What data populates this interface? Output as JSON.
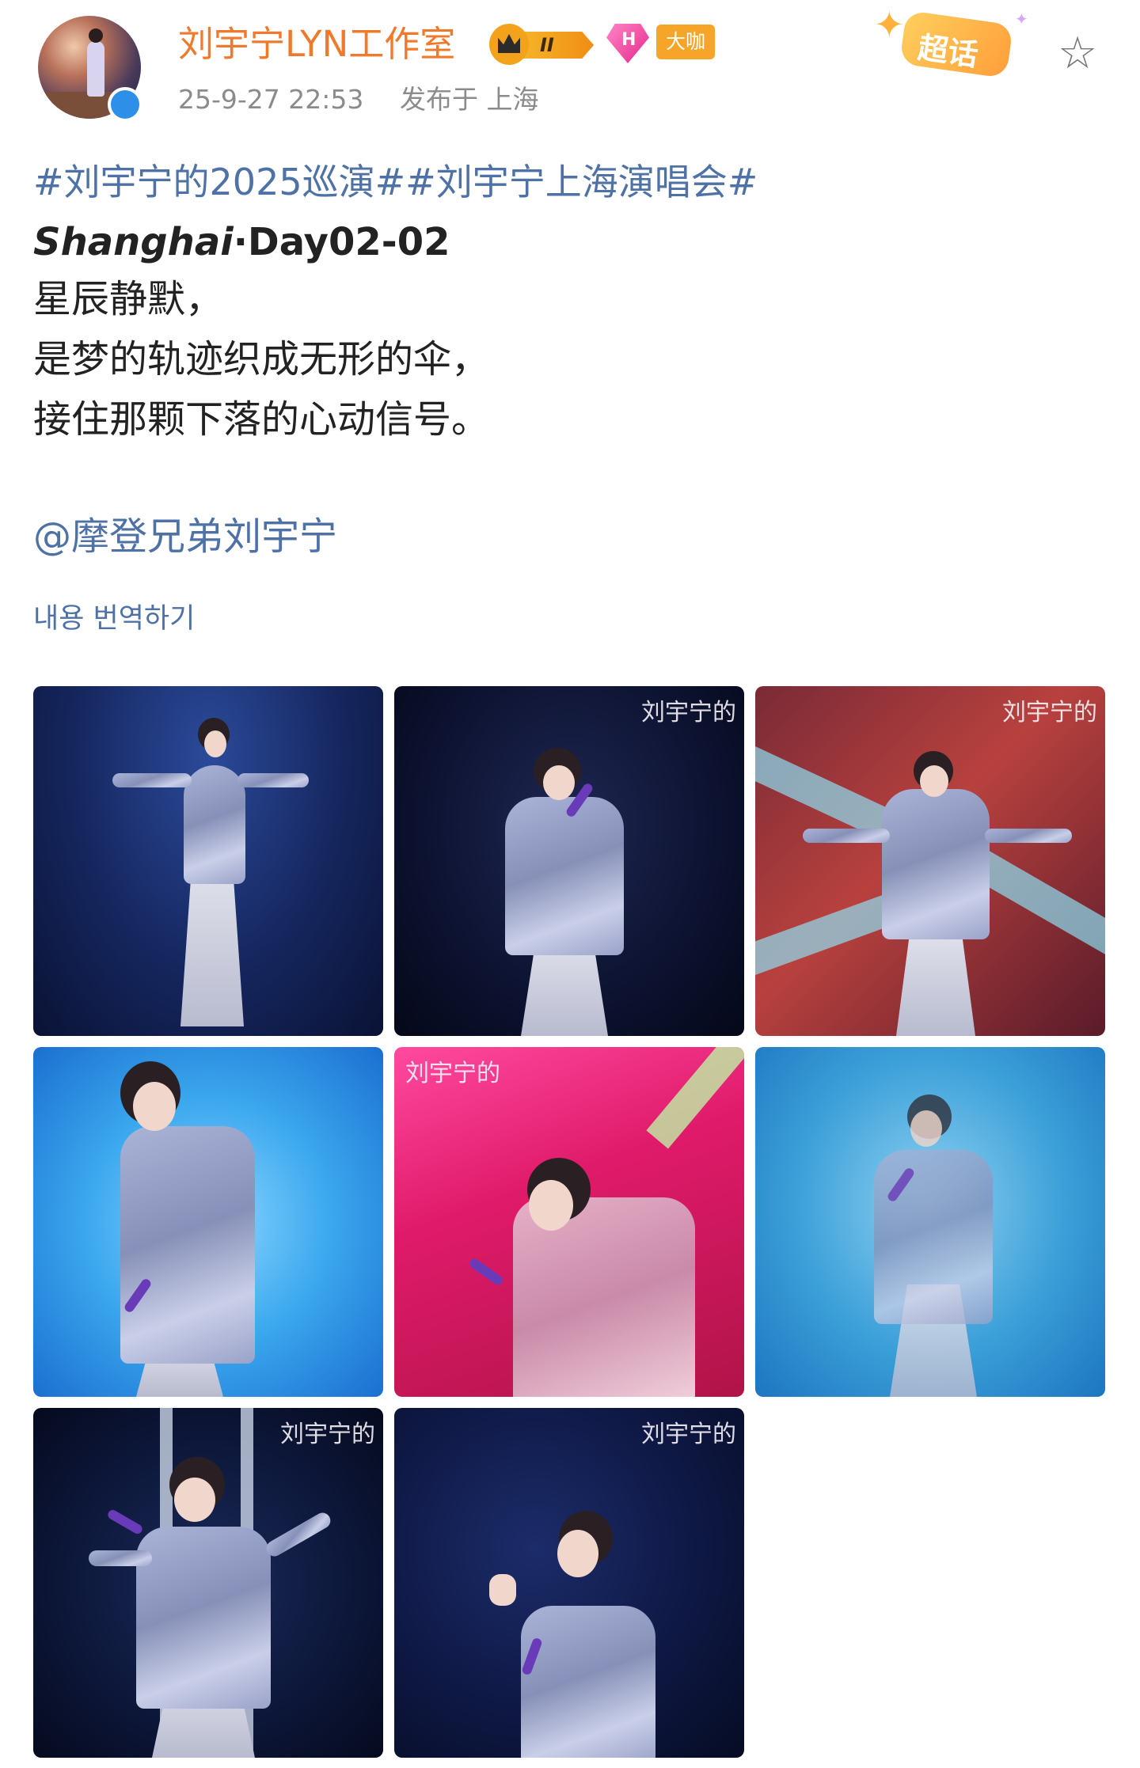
{
  "post": {
    "author": {
      "name": "刘宇宁LYN工作室",
      "level_badge": "II",
      "vip_gem": "H",
      "tag_badge": "大咖",
      "verified": true
    },
    "meta": {
      "timestamp": "25-9-27 22:53",
      "location": "发布于 上海"
    },
    "supertopic_button": "超话",
    "favorite_icon": "star-outline-icon",
    "hashtags": "#刘宇宁的2025巡演##刘宇宁上海演唱会#",
    "title_italic": "Shanghai",
    "title_rest": "·Day02-02",
    "lines": [
      "星辰静默，",
      "是梦的轨迹织成无形的伞，",
      "接住那颗下落的心动信号。"
    ],
    "mention": "@摩登兄弟刘宇宁",
    "translate_link": "내용 번역하기",
    "photo_logo": "刘宇宁的",
    "photos": [
      {
        "alt": "performer on stage in grey suit, arms spread, dark blue background"
      },
      {
        "alt": "performer singing with purple microphone, dark background"
      },
      {
        "alt": "performer with cyan light beams, red background"
      },
      {
        "alt": "close-up performer in grey suit on bright blue background"
      },
      {
        "alt": "performer singing on magenta background"
      },
      {
        "alt": "performer holding microphone, hazy blue background"
      },
      {
        "alt": "performer singing with raised hand, dark background with white light"
      },
      {
        "alt": "performer singing with raised hand, dark navy background"
      }
    ]
  },
  "colors": {
    "username": "#f07a2c",
    "link": "#4e71a6",
    "meta": "#8b8b8b",
    "badge": "#f7a529"
  }
}
